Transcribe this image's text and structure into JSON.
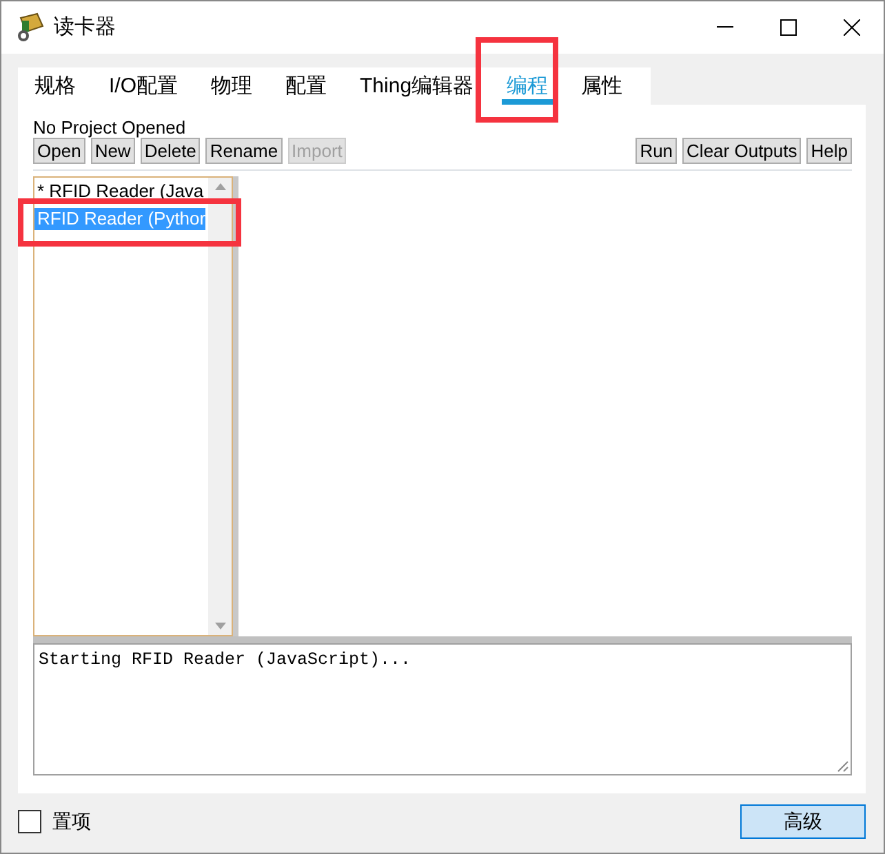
{
  "window": {
    "title": "读卡器"
  },
  "tabs": [
    {
      "label": "规格",
      "selected": false
    },
    {
      "label": "I/O配置",
      "selected": false
    },
    {
      "label": "物理",
      "selected": false
    },
    {
      "label": "配置",
      "selected": false
    },
    {
      "label": "Thing编辑器",
      "selected": false
    },
    {
      "label": "编程",
      "selected": true
    },
    {
      "label": "属性",
      "selected": false
    }
  ],
  "project_status": "No Project Opened",
  "left_buttons": [
    {
      "label": "Open",
      "disabled": false
    },
    {
      "label": "New",
      "disabled": false
    },
    {
      "label": "Delete",
      "disabled": false
    },
    {
      "label": "Rename",
      "disabled": false
    },
    {
      "label": "Import",
      "disabled": true
    }
  ],
  "right_buttons": [
    {
      "label": "Run",
      "disabled": false
    },
    {
      "label": "Clear Outputs",
      "disabled": false
    },
    {
      "label": "Help",
      "disabled": false
    }
  ],
  "scripts": [
    {
      "label": "* RFID Reader (Java",
      "selected": false
    },
    {
      "label": "RFID Reader (Pythor",
      "selected": true
    }
  ],
  "output": "Starting RFID Reader (JavaScript)...",
  "pin_checkbox": {
    "label": "置项",
    "checked": false
  },
  "advanced_button": "高级"
}
